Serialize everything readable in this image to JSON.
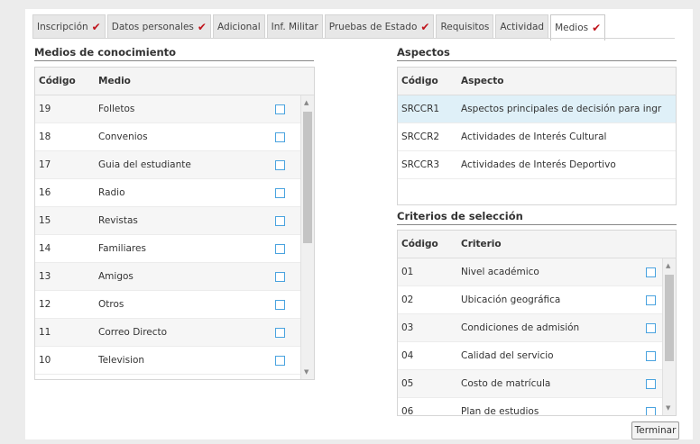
{
  "tabs": [
    {
      "label": "Inscripción",
      "checked": true
    },
    {
      "label": "Datos personales",
      "checked": true
    },
    {
      "label": "Adicional",
      "checked": false
    },
    {
      "label": "Inf. Militar",
      "checked": false
    },
    {
      "label": "Pruebas de Estado",
      "checked": true
    },
    {
      "label": "Requisitos",
      "checked": false
    },
    {
      "label": "Actividad",
      "checked": false
    },
    {
      "label": "Medios",
      "checked": true,
      "active": true
    }
  ],
  "check_mark": "✔",
  "medios": {
    "title": "Medios de conocimiento",
    "col_code": "Código",
    "col_name": "Medio",
    "rows": [
      {
        "code": "19",
        "name": "Folletos"
      },
      {
        "code": "18",
        "name": "Convenios"
      },
      {
        "code": "17",
        "name": "Guia del estudiante"
      },
      {
        "code": "16",
        "name": "Radio"
      },
      {
        "code": "15",
        "name": "Revistas"
      },
      {
        "code": "14",
        "name": "Familiares"
      },
      {
        "code": "13",
        "name": "Amigos"
      },
      {
        "code": "12",
        "name": "Otros"
      },
      {
        "code": "11",
        "name": "Correo Directo"
      },
      {
        "code": "10",
        "name": "Television"
      }
    ]
  },
  "aspectos": {
    "title": "Aspectos",
    "col_code": "Código",
    "col_name": "Aspecto",
    "rows": [
      {
        "code": "SRCCR1",
        "name": "Aspectos principales de decisión para ingr"
      },
      {
        "code": "SRCCR2",
        "name": "Actividades de Interés Cultural"
      },
      {
        "code": "SRCCR3",
        "name": "Actividades de Interés Deportivo"
      }
    ]
  },
  "criterios": {
    "title": "Criterios de selección",
    "col_code": "Código",
    "col_name": "Criterio",
    "rows": [
      {
        "code": "01",
        "name": "Nivel académico"
      },
      {
        "code": "02",
        "name": "Ubicación geográfica"
      },
      {
        "code": "03",
        "name": "Condiciones de admisión"
      },
      {
        "code": "04",
        "name": "Calidad del servicio"
      },
      {
        "code": "05",
        "name": "Costo de matrícula"
      },
      {
        "code": "06",
        "name": "Plan de estudios"
      }
    ]
  },
  "actions": {
    "finish_label": "Terminar"
  },
  "colors": {
    "check": "#c0141c",
    "checkbox_border": "#4aa3df",
    "selected_row": "#dff0f8"
  }
}
